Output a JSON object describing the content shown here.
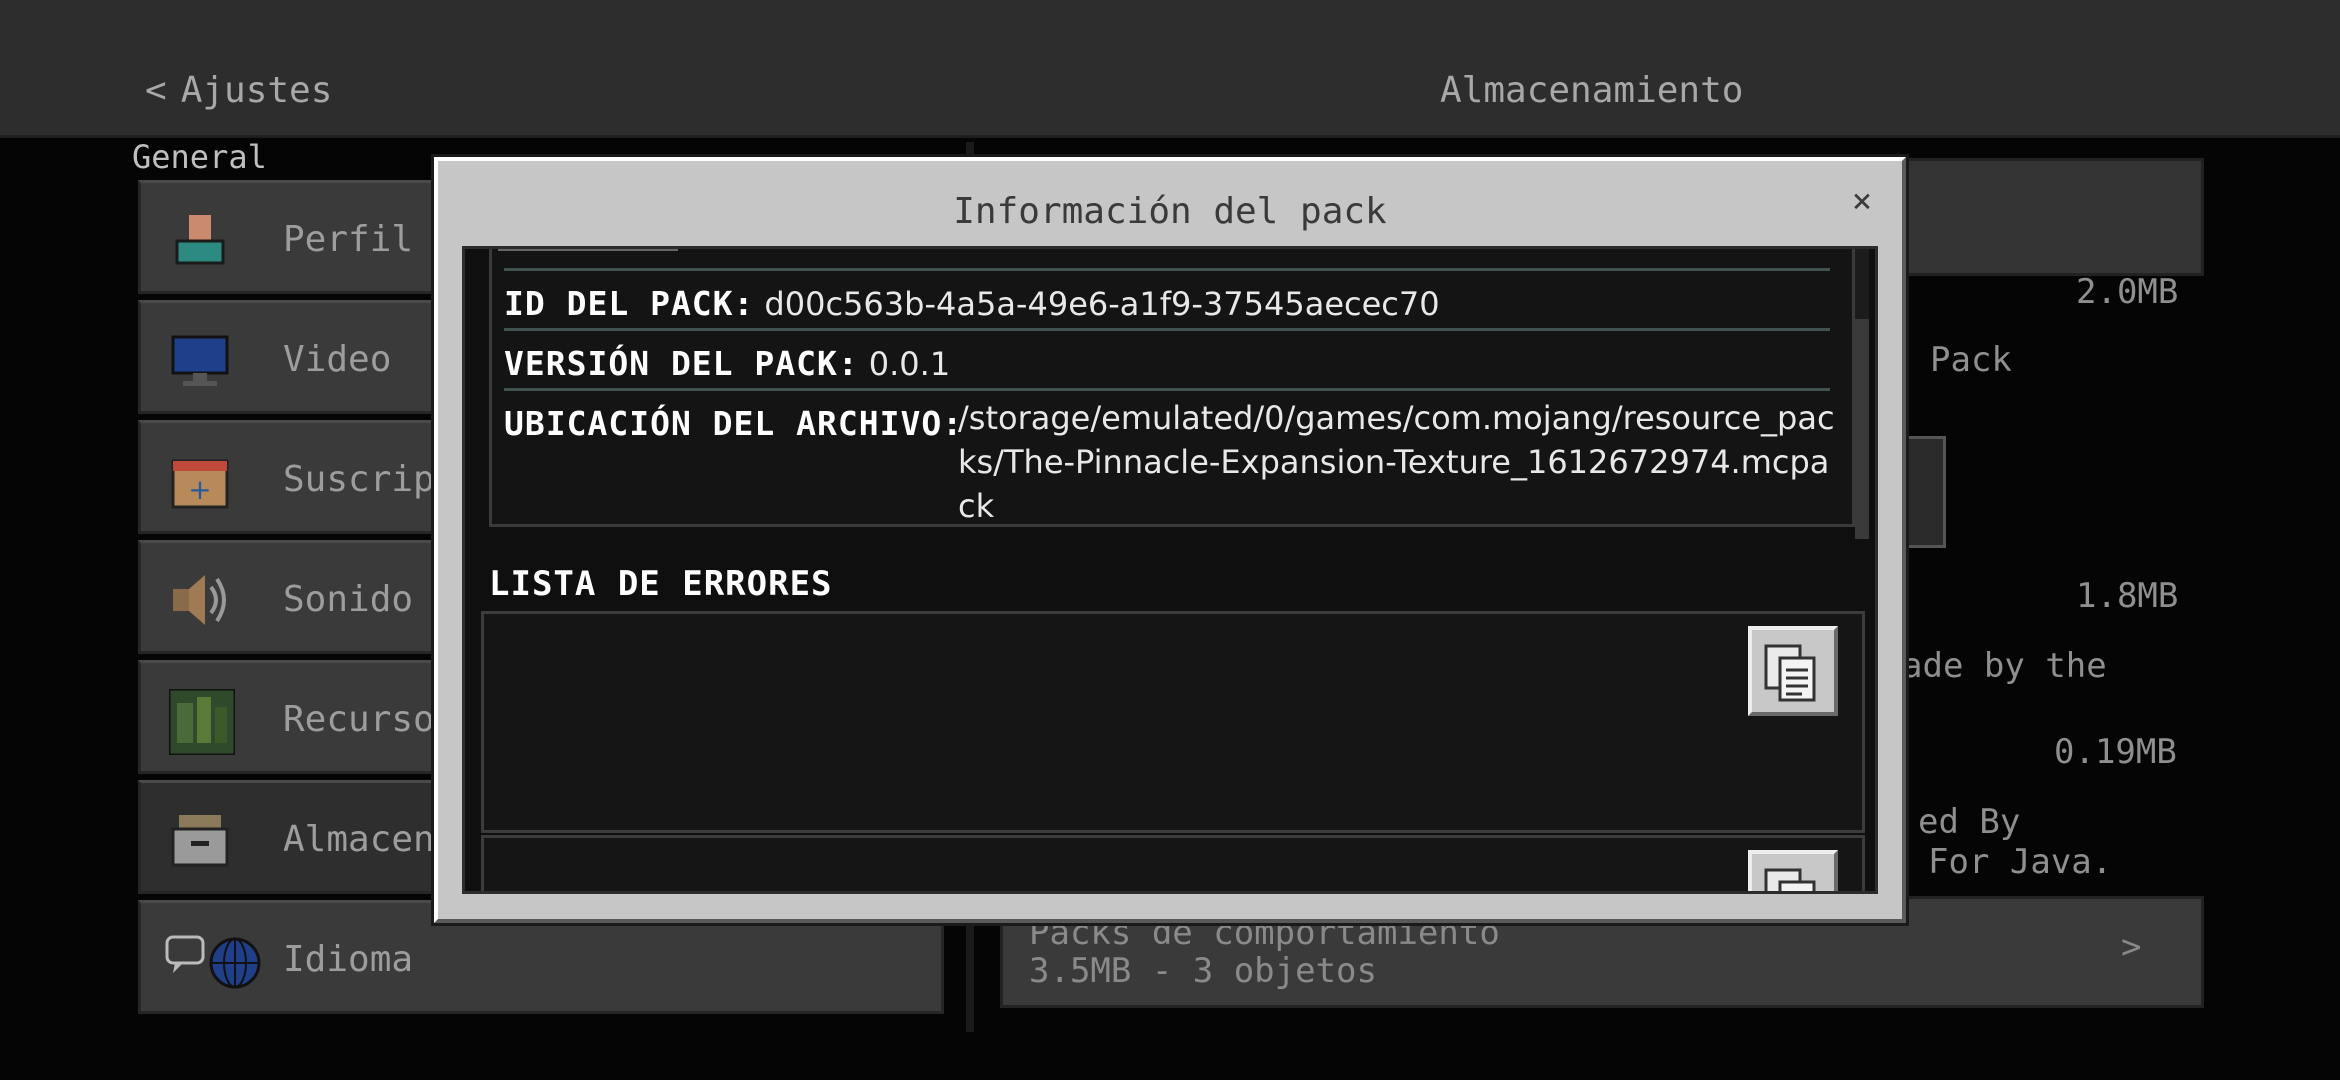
{
  "header": {
    "back_label": "Ajustes",
    "title": "Almacenamiento"
  },
  "sidebar": {
    "section": "General",
    "items": [
      {
        "label": "Perfil",
        "icon": "profile-icon"
      },
      {
        "label": "Video",
        "icon": "monitor-icon"
      },
      {
        "label": "Suscrip",
        "icon": "calendar-plus-icon"
      },
      {
        "label": "Sonido",
        "icon": "speaker-icon"
      },
      {
        "label": "Recurso",
        "icon": "resource-pack-icon"
      },
      {
        "label": "Almacen",
        "icon": "storage-box-icon"
      },
      {
        "label": "Idioma",
        "icon": "language-globe-icon"
      }
    ]
  },
  "right": {
    "size_top": "2.0MB",
    "pack_text": "Pack",
    "size_mid": "1.8MB",
    "made_text": "ade by the",
    "size_low": "0.19MB",
    "by_text": "ed By",
    "java_text": "For Java.",
    "behavior_title": "Packs de comportamiento",
    "behavior_sub": "3.5MB - 3 objetos"
  },
  "modal": {
    "title": "Información del pack",
    "close": "×",
    "id_key": "ID DEL PACK:",
    "id_value": "d00c563b-4a5a-49e6-a1f9-37545aecec70",
    "version_key": "VERSIÓN DEL PACK:",
    "version_value": "0.0.1",
    "location_key": "UBICACIÓN DEL ARCHIVO:",
    "location_value": "/storage/emulated/0/games/com.mojang/resource_packs/The-Pinnacle-Expansion-Texture_1612672974.mcpack",
    "errors_title": "LISTA DE ERRORES"
  },
  "colors": {
    "modal_bg": "#c6c6c6",
    "body_bg": "#0f0f0f",
    "separator": "#3f5450"
  }
}
